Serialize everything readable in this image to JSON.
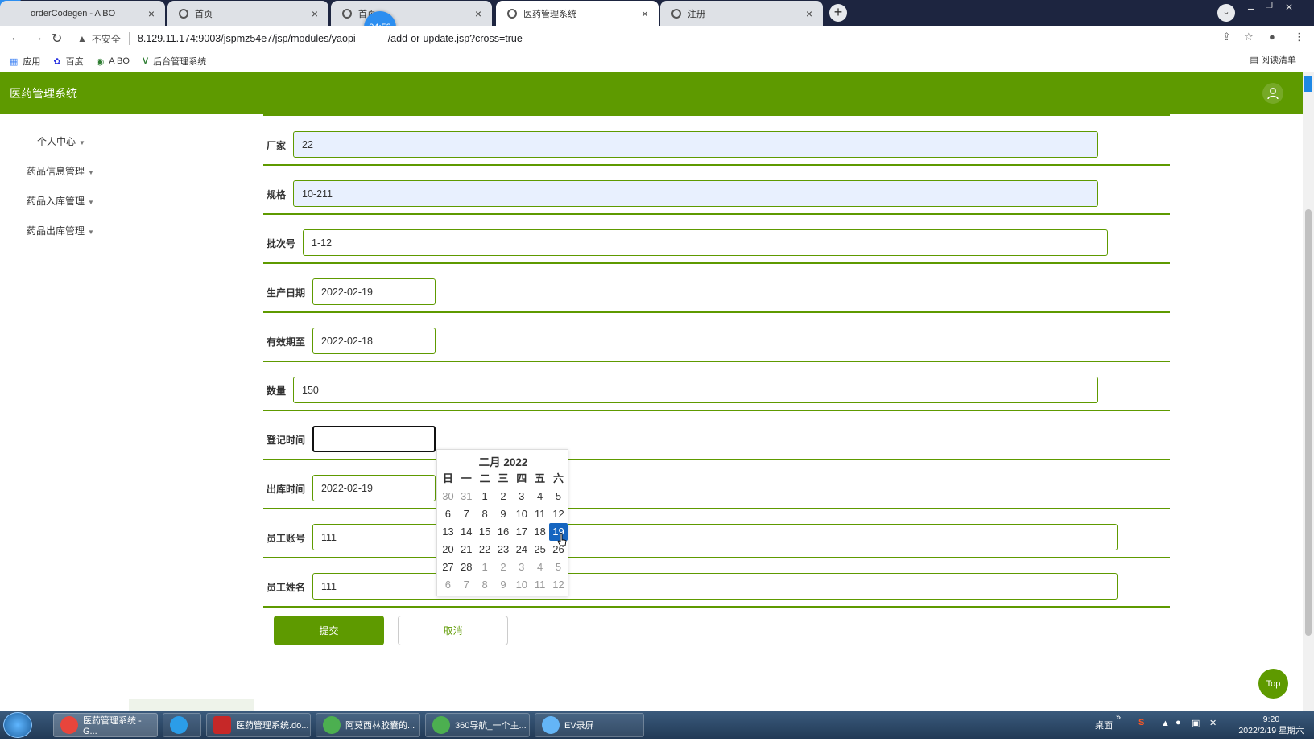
{
  "browser": {
    "tabs": [
      {
        "title": "orderCodegen - A BO",
        "active": false
      },
      {
        "title": "首页",
        "active": false
      },
      {
        "title": "首页",
        "active": false
      },
      {
        "title": "医药管理系统",
        "active": true
      },
      {
        "title": "注册",
        "active": false
      }
    ],
    "url_security": "不安全",
    "url": "8.129.11.174:9003/jspmz54e7/jsp/modules/yaopi",
    "url_tail": "/add-or-update.jsp?cross=true",
    "timer": "04:53",
    "bookmarks": [
      {
        "label": "应用",
        "icon": "apps-icon"
      },
      {
        "label": "百度",
        "icon": "baidu-icon"
      },
      {
        "label": "A BO",
        "icon": "abo-icon"
      },
      {
        "label": "后台管理系统",
        "icon": "vue-icon"
      }
    ],
    "reading_list": "阅读清单"
  },
  "app": {
    "title": "医药管理系统"
  },
  "sidebar": {
    "items": [
      {
        "label": "个人中心"
      },
      {
        "label": "药品信息管理"
      },
      {
        "label": "药品入库管理"
      },
      {
        "label": "药品出库管理"
      }
    ]
  },
  "form": {
    "fields": [
      {
        "label": "厂家",
        "value": "22"
      },
      {
        "label": "规格",
        "value": "10-211"
      },
      {
        "label": "批次号",
        "value": "1-12"
      },
      {
        "label": "生产日期",
        "value": "2022-02-19"
      },
      {
        "label": "有效期至",
        "value": "2022-02-18"
      },
      {
        "label": "数量",
        "value": "150"
      },
      {
        "label": "登记时间",
        "value": ""
      },
      {
        "label": "出库时间",
        "value": "2022-02-19"
      },
      {
        "label": "员工账号",
        "value": "111"
      },
      {
        "label": "员工姓名",
        "value": "111"
      }
    ],
    "submit_label": "提交",
    "cancel_label": "取消"
  },
  "datepicker": {
    "header": "二月 2022",
    "weekdays": [
      "日",
      "一",
      "二",
      "三",
      "四",
      "五",
      "六"
    ],
    "weeks": [
      [
        "30",
        "31",
        "1",
        "2",
        "3",
        "4",
        "5"
      ],
      [
        "6",
        "7",
        "8",
        "9",
        "10",
        "11",
        "12"
      ],
      [
        "13",
        "14",
        "15",
        "16",
        "17",
        "18",
        "19"
      ],
      [
        "20",
        "21",
        "22",
        "23",
        "24",
        "25",
        "26"
      ],
      [
        "27",
        "28",
        "1",
        "2",
        "3",
        "4",
        "5"
      ],
      [
        "6",
        "7",
        "8",
        "9",
        "10",
        "11",
        "12"
      ]
    ],
    "selected": "19"
  },
  "top_button": "Top",
  "taskbar": {
    "items": [
      {
        "label": "医药管理系统 - G...",
        "color": "#e8453c"
      },
      {
        "label": "",
        "color": "#2b9de8"
      },
      {
        "label": "医药管理系统.do...",
        "color": "#c62828"
      },
      {
        "label": "阿莫西林胶囊的...",
        "color": "#4caf50"
      },
      {
        "label": "360导航_一个主...",
        "color": "#4caf50"
      },
      {
        "label": "EV录屏",
        "color": "#64b5f6"
      }
    ],
    "desktop_label": "桌面",
    "clock_time": "9:20",
    "clock_date": "2022/2/19 星期六"
  },
  "colors": {
    "accent": "#5e9a00",
    "selected_day": "#1565c0"
  }
}
